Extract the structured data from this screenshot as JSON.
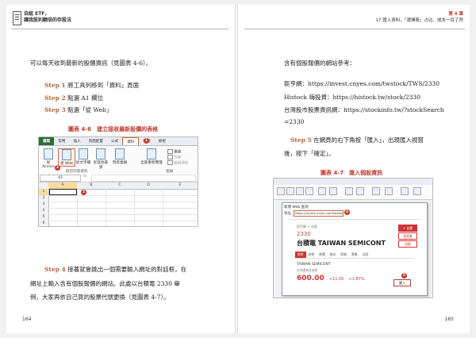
{
  "left_page": {
    "header_line1": "自組 ETF，",
    "header_line2": "讓我股利翻倍的存股法",
    "intro": "可以每天收到最新的股價資訊（見圖表 4-6）。",
    "steps": [
      {
        "label": "Step 1",
        "text": "將工具列移到「資料」頁面"
      },
      {
        "label": "Step 2",
        "text": "點選 A1 欄位"
      },
      {
        "label": "Step 3",
        "text": "點選「從 Web」"
      }
    ],
    "figure_caption": "圖表 4-6　建立接收最新股價的表格",
    "step4_label": "Step 4",
    "step4_lines": [
      "接著就會跳出一個需要輸入網址的對話框，在",
      "網址上輸入含有個股報價的網站。此處以台積電 2330 舉",
      "例，大家再依自己買的股票代號更換（見圖表 4-7）。"
    ],
    "page_number": "164"
  },
  "excel": {
    "tabs": [
      "檔案",
      "常用",
      "插入",
      "頁面配置",
      "公式",
      "資料",
      "校閱",
      "檢視"
    ],
    "ribbon_buttons": [
      "從 Access",
      "從 Web",
      "從文字檔",
      "從其他來源",
      "現有連線",
      "全部重新整理"
    ],
    "ribbon_small": [
      "連線",
      "內容",
      "編輯連結"
    ],
    "group_labels": [
      "取得外部資料",
      "連線"
    ],
    "markers": [
      "1",
      "2",
      "3"
    ],
    "name_box": "A1",
    "fx": "fx",
    "columns": [
      "A",
      "B",
      "C",
      "D",
      "E"
    ],
    "rows": [
      "1",
      "2",
      "3",
      "4",
      "5",
      "6",
      "7",
      "8",
      "9"
    ]
  },
  "right_page": {
    "header_chapter": "第 4 章",
    "header_title": "17 匯入資料，「選擇股」占比、成本一目了然",
    "intro": "含有個股報價的網站參考：",
    "sites": [
      "鉅亨網：https://invest.cnyes.com/twstock/TWS/2330",
      "Histock 嗨投資：https://histock.tw/stock/2330",
      "台灣股市股票資訊網：https://stockinfo.tw/?stockSearch"
    ],
    "site_wrap": "=2330",
    "step5_label": "Step 5",
    "step5_lines": [
      "在網頁的右下角按「匯入」，出現匯入視窗",
      "後，按下「確定」。"
    ],
    "figure_caption": "圖表 4-7　匯入個股資訊",
    "page_number": "165"
  },
  "browser": {
    "dialog_title": "新增 Web 查詢",
    "address_label": "地址",
    "address_value": "https://invest.cnyes.com/twstock/TWS/2330",
    "small_text": "鉅亨網 > 台股",
    "stock_code": "2330",
    "stock_name": "台積電 TAIWAN SEMICONT",
    "nav_items": [
      "即時",
      "技術",
      "新聞",
      "基本",
      "財務",
      "籌碼",
      "法說"
    ],
    "buttons": [
      "+ 自選",
      "股東會",
      "追蹤"
    ],
    "sub_title": "TAIWAN SEMICONT",
    "sub_small": "台灣證券交易所",
    "price": "600.00",
    "change": "+11.00",
    "change_pct": "+1.87%",
    "import_label": "匯入",
    "markers": [
      "4",
      "5"
    ]
  }
}
